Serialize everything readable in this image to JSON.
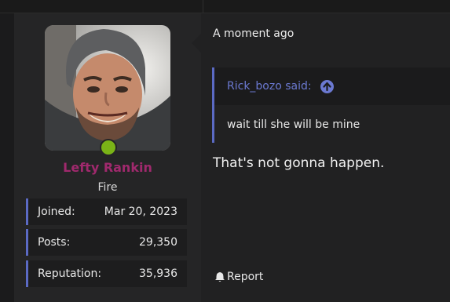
{
  "user": {
    "username": "Lefty Rankin",
    "user_title": "Fire",
    "online_status_color": "#7ab317",
    "username_color": "#a0296d",
    "stats": [
      {
        "label": "Joined:",
        "value": "Mar 20, 2023"
      },
      {
        "label": "Posts:",
        "value": "29,350"
      },
      {
        "label": "Reputation:",
        "value": "35,936"
      }
    ]
  },
  "post": {
    "date": "A moment ago",
    "quote": {
      "author": "Rick_bozo said:",
      "text": "wait till she will be mine",
      "icon": "arrow-up-circle-icon"
    },
    "body": "That's not gonna happen.",
    "actions": {
      "report_label": "Report",
      "report_icon": "bell-icon"
    }
  },
  "colors": {
    "accent": "#5b6ac4",
    "link": "#6b79d1"
  }
}
